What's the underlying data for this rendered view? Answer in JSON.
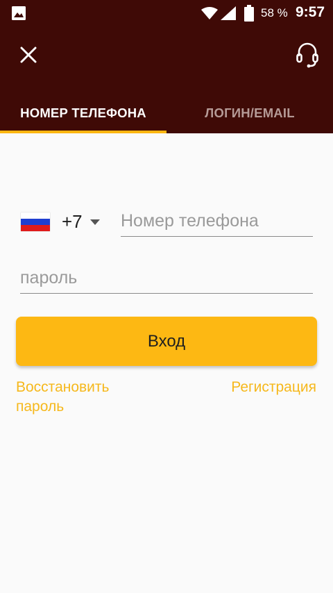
{
  "status_bar": {
    "battery_percent": "58 %",
    "time": "9:57",
    "icons": [
      "gallery-icon",
      "wifi-icon",
      "signal-icon",
      "battery-icon"
    ]
  },
  "toolbar": {
    "close_icon": "close-icon",
    "support_icon": "headset-icon"
  },
  "tabs": [
    {
      "label": "НОМЕР ТЕЛЕФОНА",
      "active": true
    },
    {
      "label": "ЛОГИН/EMAIL",
      "active": false
    }
  ],
  "form": {
    "country_code": "+7",
    "country_flag": "russia-flag-icon",
    "phone_placeholder": "Номер телефона",
    "phone_value": "",
    "password_placeholder": "пароль",
    "password_value": "",
    "login_button": "Вход",
    "restore_password": "Восстановить пароль",
    "register": "Регистрация"
  },
  "colors": {
    "header_bg": "#3f0a06",
    "accent": "#fdb813",
    "link": "#f6b81c",
    "inactive_tab": "#b59a96",
    "page_bg": "#fafafa"
  }
}
